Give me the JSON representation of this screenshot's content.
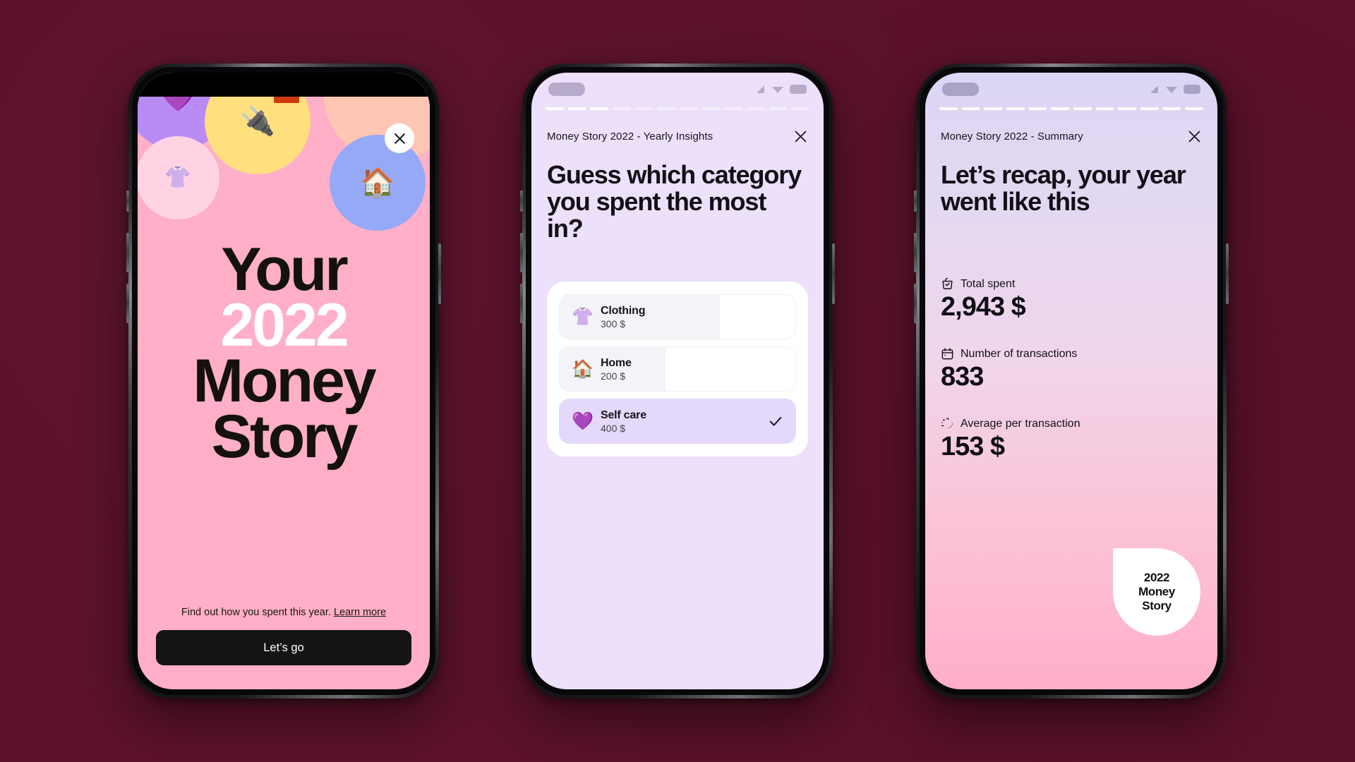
{
  "theme": {
    "page_background": "#5b1129",
    "screen1_background": "#ffafc7",
    "screen2_background": "#ece0fb",
    "screen3_gradient_top": "#dcd6f4",
    "screen3_gradient_bottom": "#ffaec8",
    "cta_background": "#141414",
    "selected_row_background": "#e4d8fb"
  },
  "screen1": {
    "close_icon": "close-icon",
    "title_line1": "Your",
    "title_year": "2022",
    "title_line3": "Money",
    "title_line4": "Story",
    "caption_text": "Find out how you spent this year.",
    "caption_link": "Learn more",
    "cta_label": "Let’s go",
    "bubbles": [
      {
        "name": "self-care-bubble",
        "emoji": "💜",
        "color": "#b98bf5"
      },
      {
        "name": "clothing-bubble",
        "emoji": "👚",
        "color": "#ffd3e4"
      },
      {
        "name": "utilities-bubble",
        "emoji": "🔌",
        "color": "#ffdf7e"
      },
      {
        "name": "groceries-bubble",
        "emoji": "",
        "color": "#ffc6b4"
      },
      {
        "name": "home-bubble",
        "emoji": "🏠",
        "color": "#96a9f7"
      }
    ]
  },
  "screen2": {
    "statusbar": {
      "time_pill": "",
      "signal_icon": "signal-icon",
      "wifi_icon": "wifi-icon",
      "battery_icon": "battery-icon"
    },
    "story_progress": {
      "total_segments": 12,
      "active_segments": 3
    },
    "header_title": "Money Story 2022 - Yearly Insights",
    "close_icon": "close-icon",
    "headline": "Guess which category you spent the most in?",
    "categories": [
      {
        "emoji": "👚",
        "name": "Clothing",
        "amount": "300 $",
        "fill_percent": 68,
        "selected": false,
        "icon_name": "clothing-icon"
      },
      {
        "emoji": "🏠",
        "name": "Home",
        "amount": "200 $",
        "fill_percent": 45,
        "selected": false,
        "icon_name": "home-icon"
      },
      {
        "emoji": "💜",
        "name": "Self care",
        "amount": "400 $",
        "fill_percent": 100,
        "selected": true,
        "icon_name": "self-care-icon"
      }
    ],
    "check_icon": "check-icon"
  },
  "screen3": {
    "statusbar": {
      "time_pill": "",
      "signal_icon": "signal-icon",
      "wifi_icon": "wifi-icon",
      "battery_icon": "battery-icon"
    },
    "story_progress": {
      "total_segments": 12,
      "active_segments": 12
    },
    "header_title": "Money Story 2022 - Summary",
    "close_icon": "close-icon",
    "headline": "Let’s recap, your year went like this",
    "stats": [
      {
        "icon": "shopping-bag-check-icon",
        "label": "Total spent",
        "value": "2,943 $"
      },
      {
        "icon": "calendar-icon",
        "label": "Number of transactions",
        "value": "833"
      },
      {
        "icon": "sparkle-icon",
        "label": "Average per transaction",
        "value": "153 $"
      }
    ],
    "badge": {
      "line1": "2022",
      "line2": "Money",
      "line3": "Story"
    }
  }
}
